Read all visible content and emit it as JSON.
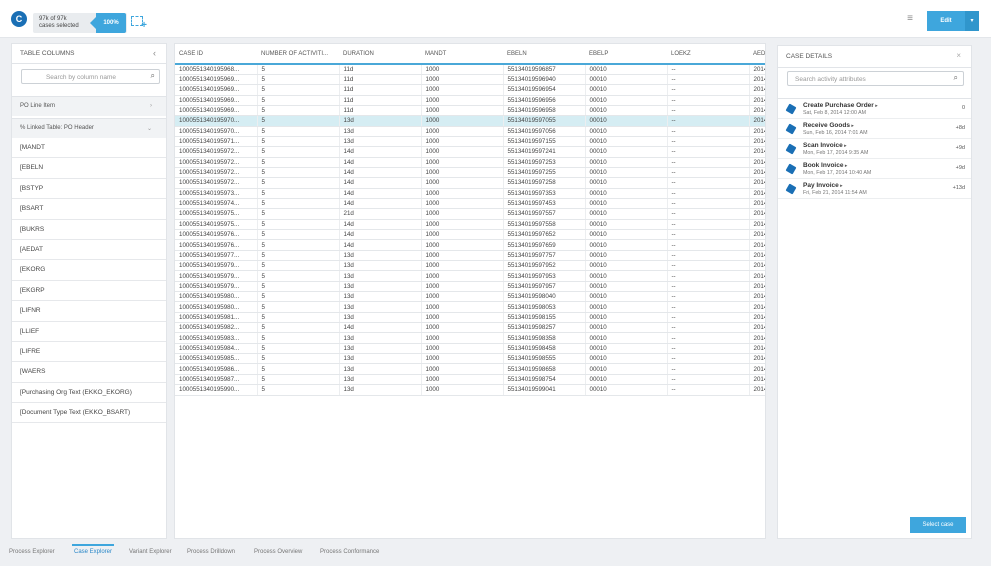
{
  "topbar": {
    "logo": "C",
    "selection_line1": "97k of 97k",
    "selection_line2": "cases selected",
    "selection_pct": "100%",
    "edit_label": "Edit",
    "edit_caret": "▾",
    "menu_icon": "hamburger-icon",
    "add_selection_icon": "add-selection-icon"
  },
  "left_panel": {
    "title": "TABLE COLUMNS",
    "search_placeholder": "Search by column name",
    "groups": [
      {
        "label": "PO Line Item",
        "chevron": "›"
      },
      {
        "label": "% Linked Table: PO Header",
        "chevron": "⌄"
      }
    ],
    "items": [
      "[MANDT",
      "[EBELN",
      "[BSTYP",
      "[BSART",
      "[BUKRS",
      "[AEDAT",
      "[EKORG",
      "[EKGRP",
      "[LIFNR",
      "[LLIEF",
      "[LIFRE",
      "[WAERS",
      "[Purchasing Org Text (EKKO_EKORG)",
      "[Document Type Text (EKKO_BSART)"
    ]
  },
  "table": {
    "columns": [
      "CASE ID",
      "NUMBER OF ACTIVITI...",
      "DURATION",
      "MANDT",
      "EBELN",
      "EBELP",
      "LOEKZ",
      "AEDAT"
    ],
    "selected_row": 6,
    "rows": [
      [
        "1000551340195968...",
        "5",
        "11d",
        "1000",
        "55134019596857",
        "00010",
        "--",
        "2014"
      ],
      [
        "1000551340195969...",
        "5",
        "11d",
        "1000",
        "55134019596940",
        "00010",
        "--",
        "2014"
      ],
      [
        "1000551340195969...",
        "5",
        "11d",
        "1000",
        "55134019596954",
        "00010",
        "--",
        "2014"
      ],
      [
        "1000551340195969...",
        "5",
        "11d",
        "1000",
        "55134019596956",
        "00010",
        "--",
        "2014"
      ],
      [
        "1000551340195969...",
        "5",
        "11d",
        "1000",
        "55134019596958",
        "00010",
        "--",
        "2014"
      ],
      [
        "1000551340195970...",
        "5",
        "13d",
        "1000",
        "55134019597055",
        "00010",
        "--",
        "2014"
      ],
      [
        "1000551340195970...",
        "5",
        "13d",
        "1000",
        "55134019597056",
        "00010",
        "--",
        "2014"
      ],
      [
        "1000551340195971...",
        "5",
        "13d",
        "1000",
        "55134019597155",
        "00010",
        "--",
        "2014"
      ],
      [
        "1000551340195972...",
        "5",
        "14d",
        "1000",
        "55134019597241",
        "00010",
        "--",
        "2014"
      ],
      [
        "1000551340195972...",
        "5",
        "14d",
        "1000",
        "55134019597253",
        "00010",
        "--",
        "2014"
      ],
      [
        "1000551340195972...",
        "5",
        "14d",
        "1000",
        "55134019597255",
        "00010",
        "--",
        "2014"
      ],
      [
        "1000551340195972...",
        "5",
        "14d",
        "1000",
        "55134019597258",
        "00010",
        "--",
        "2014"
      ],
      [
        "1000551340195973...",
        "5",
        "14d",
        "1000",
        "55134019597353",
        "00010",
        "--",
        "2014"
      ],
      [
        "1000551340195974...",
        "5",
        "14d",
        "1000",
        "55134019597453",
        "00010",
        "--",
        "2014"
      ],
      [
        "1000551340195975...",
        "5",
        "21d",
        "1000",
        "55134019597557",
        "00010",
        "--",
        "2014"
      ],
      [
        "1000551340195975...",
        "5",
        "14d",
        "1000",
        "55134019597558",
        "00010",
        "--",
        "2014"
      ],
      [
        "1000551340195976...",
        "5",
        "14d",
        "1000",
        "55134019597652",
        "00010",
        "--",
        "2014"
      ],
      [
        "1000551340195976...",
        "5",
        "14d",
        "1000",
        "55134019597659",
        "00010",
        "--",
        "2014"
      ],
      [
        "1000551340195977...",
        "5",
        "13d",
        "1000",
        "55134019597757",
        "00010",
        "--",
        "2014"
      ],
      [
        "1000551340195979...",
        "5",
        "13d",
        "1000",
        "55134019597952",
        "00010",
        "--",
        "2014"
      ],
      [
        "1000551340195979...",
        "5",
        "13d",
        "1000",
        "55134019597953",
        "00010",
        "--",
        "2014"
      ],
      [
        "1000551340195979...",
        "5",
        "13d",
        "1000",
        "55134019597957",
        "00010",
        "--",
        "2014"
      ],
      [
        "1000551340195980...",
        "5",
        "13d",
        "1000",
        "55134019598040",
        "00010",
        "--",
        "2014"
      ],
      [
        "1000551340195980...",
        "5",
        "13d",
        "1000",
        "55134019598053",
        "00010",
        "--",
        "2014"
      ],
      [
        "1000551340195981...",
        "5",
        "13d",
        "1000",
        "55134019598155",
        "00010",
        "--",
        "2014"
      ],
      [
        "1000551340195982...",
        "5",
        "14d",
        "1000",
        "55134019598257",
        "00010",
        "--",
        "2014"
      ],
      [
        "1000551340195983...",
        "5",
        "13d",
        "1000",
        "55134019598358",
        "00010",
        "--",
        "2014"
      ],
      [
        "1000551340195984...",
        "5",
        "13d",
        "1000",
        "55134019598458",
        "00010",
        "--",
        "2014"
      ],
      [
        "1000551340195985...",
        "5",
        "13d",
        "1000",
        "55134019598555",
        "00010",
        "--",
        "2014"
      ],
      [
        "1000551340195986...",
        "5",
        "13d",
        "1000",
        "55134019598658",
        "00010",
        "--",
        "2014"
      ],
      [
        "1000551340195987...",
        "5",
        "13d",
        "1000",
        "55134019598754",
        "00010",
        "--",
        "2014"
      ],
      [
        "1000551340195990...",
        "5",
        "13d",
        "1000",
        "55134019599041",
        "00010",
        "--",
        "2014"
      ]
    ]
  },
  "case_details": {
    "title": "CASE DETAILS",
    "close": "×",
    "search_placeholder": "Search activity attributes",
    "activities": [
      {
        "name": "Create Purchase Order",
        "date": "Sat, Feb 8, 2014 12:00 AM",
        "duration": "0"
      },
      {
        "name": "Receive Goods",
        "date": "Sun, Feb 16, 2014 7:01 AM",
        "duration": "+8d"
      },
      {
        "name": "Scan Invoice",
        "date": "Mon, Feb 17, 2014 9:35 AM",
        "duration": "+9d"
      },
      {
        "name": "Book Invoice",
        "date": "Mon, Feb 17, 2014 10:40 AM",
        "duration": "+9d"
      },
      {
        "name": "Pay Invoice",
        "date": "Fri, Feb 21, 2014 11:54 AM",
        "duration": "+13d"
      }
    ],
    "select_case_label": "Select case"
  },
  "tabs": [
    "Process Explorer",
    "Case Explorer",
    "Variant Explorer",
    "Process Drilldown",
    "Process Overview",
    "Process Conformance"
  ],
  "active_tab": 1,
  "colors": {
    "accent": "#3ea6dd",
    "brand": "#1a6fb5",
    "selected_row": "#d5edf3"
  }
}
